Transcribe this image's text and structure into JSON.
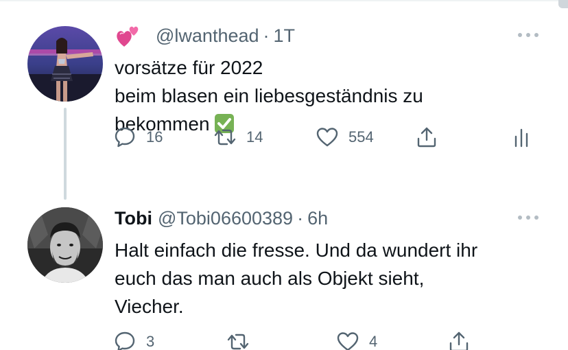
{
  "thread": [
    {
      "author": {
        "display_name": "",
        "handle": "@lwanthead",
        "avatar": "profile-photo-dancer",
        "name_emoji": "two-hearts-emoji"
      },
      "separator": "·",
      "time": "1T",
      "text_lines": [
        "vorsätze für 2022",
        "beim blasen ein liebesgeständnis zu",
        "bekommen"
      ],
      "trailing_emoji": "check-mark-button-emoji",
      "actions": {
        "replies": "16",
        "retweets": "14",
        "likes": "554"
      }
    },
    {
      "author": {
        "display_name": "Tobi",
        "handle": "@Tobi06600389",
        "avatar": "profile-photo-man"
      },
      "separator": "·",
      "time": "6h",
      "text_lines": [
        "Halt einfach die fresse. Und da wundert ihr",
        "euch das man auch als Objekt sieht,",
        "Viecher."
      ],
      "actions": {
        "replies": "3",
        "retweets": "",
        "likes": "4"
      }
    }
  ],
  "colors": {
    "text_primary": "#0f1419",
    "text_secondary": "#536471",
    "thread_line": "#cfd9de"
  }
}
